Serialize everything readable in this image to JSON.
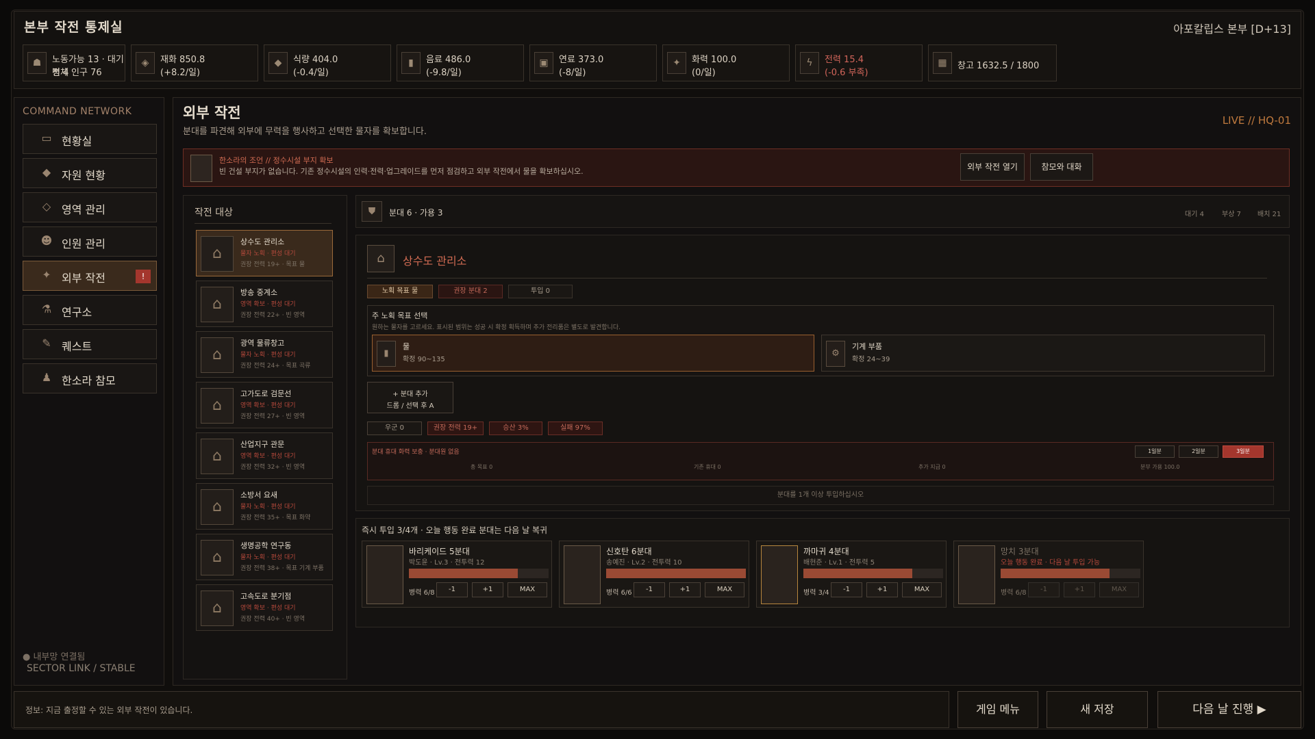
{
  "header": {
    "title": "본부 작전 통제실",
    "base": "아포칼립스 본부 [D+13]"
  },
  "resources": [
    {
      "icon": "population-icon",
      "l1": "노동가능 13 · 대기병 4",
      "l2": "전체 인구 76"
    },
    {
      "icon": "money-icon",
      "l1": "재화 850.8",
      "l2": "(+8.2/일)"
    },
    {
      "icon": "food-icon",
      "l1": "식량 404.0",
      "l2": "(-0.4/일)"
    },
    {
      "icon": "water-icon",
      "l1": "음료 486.0",
      "l2": "(-9.8/일)"
    },
    {
      "icon": "fuel-icon",
      "l1": "연료 373.0",
      "l2": "(-8/일)"
    },
    {
      "icon": "firepower-icon",
      "l1": "화력 100.0",
      "l2": "(0/일)"
    },
    {
      "icon": "power-icon",
      "l1": "전력 15.4",
      "l2": "(-0.6 부족)",
      "warn": true
    },
    {
      "icon": "storage-icon",
      "l1": "창고 1632.5 / 1800",
      "l2": ""
    }
  ],
  "sidebar": {
    "heading": "COMMAND NETWORK",
    "items": [
      {
        "label": "현황실",
        "icon": "map-icon"
      },
      {
        "label": "자원 현황",
        "icon": "resource-icon"
      },
      {
        "label": "영역 관리",
        "icon": "territory-icon"
      },
      {
        "label": "인원 관리",
        "icon": "personnel-icon"
      },
      {
        "label": "외부 작전",
        "icon": "operation-icon",
        "badge": "!"
      },
      {
        "label": "연구소",
        "icon": "research-icon"
      },
      {
        "label": "퀘스트",
        "icon": "quest-icon"
      },
      {
        "label": "한소라 참모",
        "icon": "advisor-icon"
      }
    ],
    "status1": "● 내부망 연결됨",
    "status2": "SECTOR LINK / STABLE"
  },
  "main": {
    "title": "외부 작전",
    "subtitle": "분대를 파견해 외부에 무력을 행사하고 선택한 물자를 확보합니다.",
    "live": "LIVE  //  HQ-01"
  },
  "alert": {
    "l1": "한소라의 조언  //  정수시설 부지 확보",
    "l2": "빈 건설 부지가 없습니다. 기존 정수시설의 인력·전력·업그레이드를 먼저 점검하고 외부 작전에서 물을 확보하십시오.",
    "btn1": "외부 작전 열기",
    "btn2": "참모와 대화"
  },
  "targets": {
    "heading": "작전 대상",
    "items": [
      {
        "name": "상수도 관리소",
        "status": "물자 노획 · 편성 대기",
        "detail": "권장 전력 19+ · 목표 물"
      },
      {
        "name": "방송 중계소",
        "status": "영역 확보 · 편성 대기",
        "detail": "권장 전력 22+ · 빈 영역"
      },
      {
        "name": "광역 물류창고",
        "status": "물자 노획 · 편성 대기",
        "detail": "권장 전력 24+ · 목표 곡류"
      },
      {
        "name": "고가도로 검문선",
        "status": "영역 확보 · 편성 대기",
        "detail": "권장 전력 27+ · 빈 영역"
      },
      {
        "name": "산업지구 관문",
        "status": "영역 확보 · 편성 대기",
        "detail": "권장 전력 32+ · 빈 영역"
      },
      {
        "name": "소방서 요새",
        "status": "물자 노획 · 편성 대기",
        "detail": "권장 전력 35+ · 목표 화약"
      },
      {
        "name": "생명공학 연구동",
        "status": "물자 노획 · 편성 대기",
        "detail": "권장 전력 38+ · 목표 기계 부품"
      },
      {
        "name": "고속도로 분기점",
        "status": "영역 확보 · 편성 대기",
        "detail": "권장 전력 40+ · 빈 영역"
      }
    ]
  },
  "squadbar": {
    "label": "분대 6 · 가용 3",
    "r1": "대기 4",
    "r2": "부상 7",
    "r3": "배치 21"
  },
  "detail": {
    "title": "상수도 관리소",
    "chips": [
      "노획 목표 물",
      "권장 분대 2",
      "투입 0"
    ],
    "goal_title": "주 노획 목표 선택",
    "goal_desc": "원하는 물자를 고르세요. 표시된 범위는 성공 시 확정 획득하며 추가 전리품은 별도로 발견합니다.",
    "opts": [
      {
        "name": "물",
        "range": "확정 90~135"
      },
      {
        "name": "기계 부품",
        "range": "확정 24~39"
      }
    ],
    "add_squad": [
      "+ 분대 추가",
      "드롭 / 선택 후 A"
    ],
    "stats": [
      "우군 0",
      "권장 전력 19+",
      "승산 3%",
      "실패 97%"
    ],
    "bonus": "분대 휴대 화력 보충 · 분대원 없음",
    "b_items": [
      "총 목표 0",
      "기존 휴대 0",
      "추가 지급 0",
      "분부 가용 100.0"
    ],
    "rate_btns": [
      "1일분",
      "2일분",
      "3일분"
    ],
    "notice": "분대를 1개 이상 투입하십시오"
  },
  "deploy": {
    "heading": "즉시 투입 3/4개 · 오늘 행동 완료 분대는 다음 날 복귀",
    "cards": [
      {
        "name": "바리케이드 5분대",
        "sub": "박도윤 · Lv.3 · 전투력 12",
        "hp": 0.78,
        "troops": "병력 6/8",
        "b1": "-1",
        "b2": "+1",
        "b3": "MAX"
      },
      {
        "name": "신호탄 6분대",
        "sub": "송예진 · Lv.2 · 전투력 10",
        "hp": 1.0,
        "troops": "병력 6/6",
        "b1": "-1",
        "b2": "+1",
        "b3": "MAX"
      },
      {
        "name": "까마귀 4분대",
        "sub": "배현준 · Lv.1 · 전투력 5",
        "hp": 0.78,
        "troops": "병력 3/4",
        "b1": "-1",
        "b2": "+1",
        "b3": "MAX"
      },
      {
        "name": "망치 3분대",
        "sub": "오늘 행동 완료 · 다음 날 투입 가능",
        "hp": 0.78,
        "troops": "병력 6/8",
        "b1": "-1",
        "b2": "+1",
        "b3": "MAX",
        "dim": true
      }
    ]
  },
  "footer": {
    "info": "정보: 지금 출정할 수 있는 외부 작전이 있습니다.",
    "menu": "게임 메뉴",
    "save": "새 저장",
    "next": "다음 날 진행 ▶"
  },
  "colors": {
    "accent": "#c07a3e",
    "alert": "#a4362d"
  }
}
